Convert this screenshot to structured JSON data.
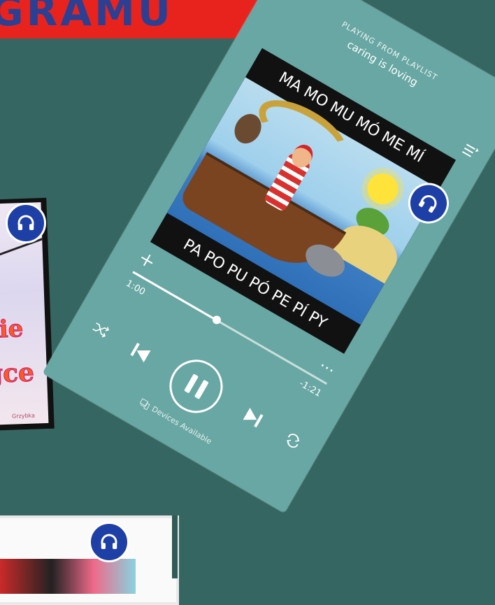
{
  "banner": {
    "title": "GRAMU"
  },
  "left_card": {
    "word1": "ie",
    "word2": "gce",
    "author": "Grzybka"
  },
  "player": {
    "playing_from": "PLAYING FROM PLAYLIST",
    "playlist_name": "caring is loving",
    "album_top_text": "MA MO MU MÓ ME MÍ",
    "album_bottom_text": "PA PO PU PÓ PE PÍ PY",
    "elapsed": "1:00",
    "remaining": "-1:21",
    "progress": 0.43,
    "devices_label": "Devices Available",
    "icons": {
      "collapse": "chevron-down-icon",
      "queue": "queue-icon",
      "add": "plus-icon",
      "more": "more-icon",
      "shuffle": "shuffle-icon",
      "previous": "skip-previous-icon",
      "pause": "pause-icon",
      "next": "skip-next-icon",
      "repeat": "repeat-icon",
      "devices": "devices-icon",
      "headphones": "headphones-icon"
    }
  },
  "colors": {
    "background": "#356662",
    "player": "#68a7a3",
    "banner": "#e8231e",
    "banner_text": "#2b3f93",
    "badge": "#1e3fa6"
  }
}
